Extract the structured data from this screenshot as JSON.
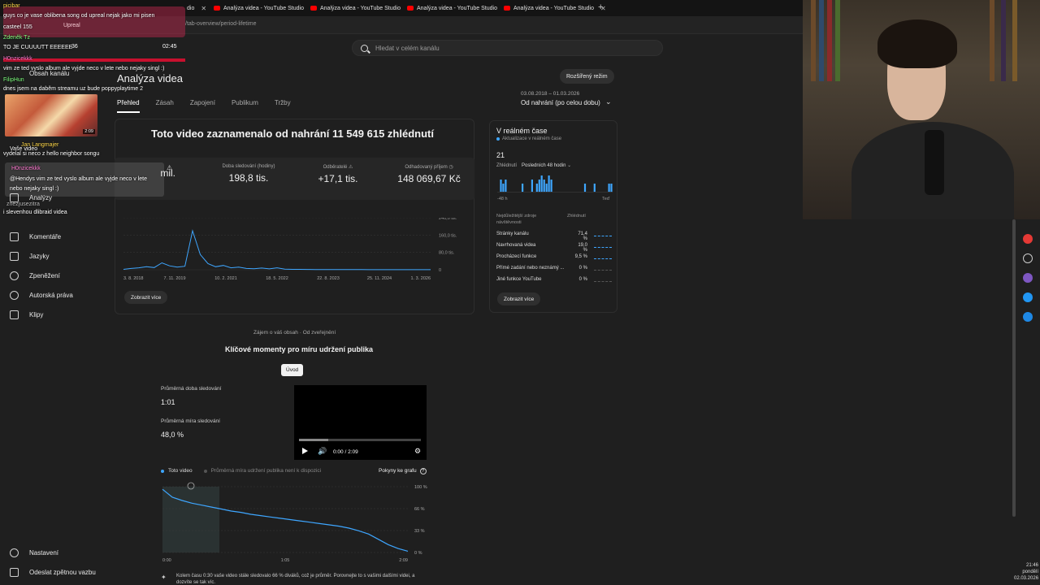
{
  "browser": {
    "tabs": [
      {
        "title": "Analýza videa - YouTube Studio"
      },
      {
        "title": "Analýza videa - YouTube Studio"
      },
      {
        "title": "Analýza videa - YouTube Studio"
      },
      {
        "title": "Analýza videa - YouTube Studio"
      },
      {
        "title": "Analýza videa - YouTube Studio"
      }
    ],
    "first_tab_tail": "dio",
    "url": "/tab-overview/period-lifetime"
  },
  "header": {
    "search_placeholder": "Hledat v celém kanálu",
    "page_title": "Analýza videa",
    "advanced_mode": "Rozšířený režim"
  },
  "tabs": [
    "Přehled",
    "Zásah",
    "Zapojení",
    "Publikum",
    "Tržby"
  ],
  "date_range": {
    "dates": "03.08.2018 – 01.03.2026",
    "label": "Od nahrání (po celou dobu)"
  },
  "sidebar": {
    "items": [
      {
        "label": "Analýzy"
      },
      {
        "label": "Komentáře"
      },
      {
        "label": "Jazyky"
      },
      {
        "label": "Zpeněžení"
      },
      {
        "label": "Autorská práva"
      },
      {
        "label": "Klipy"
      }
    ],
    "bottom": [
      {
        "label": "Nastavení"
      },
      {
        "label": "Odeslat zpětnou vazbu"
      }
    ],
    "channel_content": "Obsah kanálu"
  },
  "overview": {
    "headline": "Toto video zaznamenalo od nahrání 11 549 615 zhlédnutí",
    "stats": [
      {
        "label": "",
        "value": "mil."
      },
      {
        "label": "Doba sledování (hodiny)",
        "value": "198,8 tis."
      },
      {
        "label": "Odběratelé",
        "value": "+17,1 tis."
      },
      {
        "label": "Odhadovaný příjem",
        "value": "148 069,67 Kč"
      }
    ],
    "more": "Zobrazit více"
  },
  "chart_data": [
    {
      "type": "line",
      "title": "",
      "xlabel": "",
      "ylabel": "",
      "x_ticks": [
        "3. 8. 2018",
        "7. 11. 2019",
        "10. 2. 2021",
        "18. 5. 2022",
        "22. 8. 2023",
        "25. 11. 2024",
        "1. 3. 2026"
      ],
      "y_ticks": [
        "240,0 tis.",
        "160,0 tis.",
        "80,0 tis.",
        "0"
      ],
      "ylim": [
        0,
        240000
      ],
      "series": [
        {
          "values": [
            2000,
            6000,
            9000,
            14000,
            10000,
            32000,
            18000,
            12000,
            16000,
            180000,
            70000,
            28000,
            14000,
            20000,
            9000,
            12000,
            6000,
            5000,
            8000,
            4000,
            9000,
            3000,
            2000,
            2000,
            1500,
            1000,
            1000,
            900,
            800,
            700,
            600,
            600,
            500,
            500,
            400,
            400,
            400,
            300,
            300,
            300,
            300
          ]
        }
      ]
    },
    {
      "type": "bar",
      "title": "",
      "x_ticks": [
        "-48 h",
        "Teď"
      ],
      "values": [
        0,
        3,
        2,
        3,
        0,
        0,
        0,
        0,
        0,
        0,
        2,
        0,
        0,
        0,
        3,
        0,
        2,
        3,
        4,
        3,
        2,
        4,
        3,
        0,
        0,
        0,
        0,
        0,
        0,
        0,
        0,
        0,
        0,
        0,
        0,
        0,
        2,
        0,
        0,
        0,
        2,
        0,
        0,
        0,
        0,
        0,
        2,
        2
      ]
    },
    {
      "type": "line",
      "title": "",
      "x_ticks": [
        "0:00",
        "1:05",
        "2:09"
      ],
      "y_ticks": [
        "100 %",
        "66 %",
        "33 %",
        "0 %"
      ],
      "ylim": [
        0,
        100
      ],
      "series": [
        {
          "name": "Toto video",
          "values": [
            96,
            84,
            79,
            75,
            72,
            69,
            66,
            63,
            61,
            58,
            56,
            54,
            52,
            50,
            48,
            46,
            44,
            42,
            40,
            37,
            33,
            28,
            20,
            12,
            6,
            2
          ]
        }
      ]
    }
  ],
  "realtime": {
    "title": "V reálném čase",
    "subtitle": "Aktualizace v reálném čase",
    "count": "21",
    "views_label": "Zhlédnutí",
    "period": "Posledních 48 hodin",
    "axis_left": "-48 h",
    "axis_right": "Teď",
    "sources_head": "Nejdůležitější zdroje návštěvnosti",
    "views_head": "Zhlédnutí",
    "sources": [
      {
        "name": "Stránky kanálu",
        "value": "71,4 %"
      },
      {
        "name": "Navrhovaná videa",
        "value": "19,0 %"
      },
      {
        "name": "Procházecí funkce",
        "value": "9,5 %"
      },
      {
        "name": "Přímé zadání nebo neznámý ...",
        "value": "0 %"
      },
      {
        "name": "Jiné funkce YouTube",
        "value": "0 %"
      }
    ],
    "more": "Zobrazit více"
  },
  "key_moments": {
    "subtitle": "Zájem o váš obsah · Od zveřejnění",
    "title": "Klíčové momenty pro míru udržení publika",
    "chip": "Úvod",
    "avg_duration_label": "Průměrná doba sledování",
    "avg_duration": "1:01",
    "avg_rate_label": "Průměrná míra sledování",
    "avg_rate": "48,0 %",
    "player_time": "0:00 / 2:09",
    "legend_this": "Toto video",
    "legend_avg": "Průměrná míra udržení publika není k dispozici",
    "graph_help": "Pokyny ke grafu",
    "note": "Kolem času 0:30 vaše video stále sledovalo 66 % diváků, což je průměr. Porovnejte to s vašimi dalšími videi, a dozvíte se tak víc."
  },
  "chat": {
    "messages": [
      {
        "user": "picibar",
        "text": ""
      },
      {
        "user": "",
        "text": "guys co je vase oblibena song od upreal nejak jako mi pisen"
      },
      {
        "user": "",
        "text": "casteel 155"
      },
      {
        "user": "Zdeněk Tz",
        "text": ""
      },
      {
        "user": "",
        "text": "TO JE CUUUUTT EEEEEE"
      },
      {
        "user": "H0nzicekkk",
        "text": ""
      },
      {
        "user": "",
        "text": "vim ze ted vyslo album ale vyjde neco v lete nebo nejaky singl :)"
      },
      {
        "user": "FilipHun",
        "text": ""
      },
      {
        "user": "",
        "text": "dnes jsem na daběm streamu uz bude poppyplaytime 2"
      },
      {
        "user": "Jan Langmajer",
        "text": ""
      },
      {
        "user": "",
        "text": "vydelal si neco z hello neighbor songu"
      },
      {
        "user": "H0nzicekkk",
        "text": ""
      },
      {
        "user": "",
        "text": "@Hendys vim ze ted vyslo album ale vyjde neco v lete nebo nejaky singl :)"
      }
    ],
    "upreal": "Upreal",
    "t_left": "36",
    "t_right": "02:45",
    "thumb_duration": "2:09",
    "side1": "Vaše video",
    "side2": "znezjusezitra",
    "side3": "i slevenhou dlibraid videa"
  },
  "clock": {
    "time": "21:46",
    "day": "pondělí",
    "date": "02.03.2026"
  },
  "colors": {
    "accent": "#3ea6ff",
    "youtube_red": "#ff0000",
    "chat_bar": "#c8102e"
  }
}
